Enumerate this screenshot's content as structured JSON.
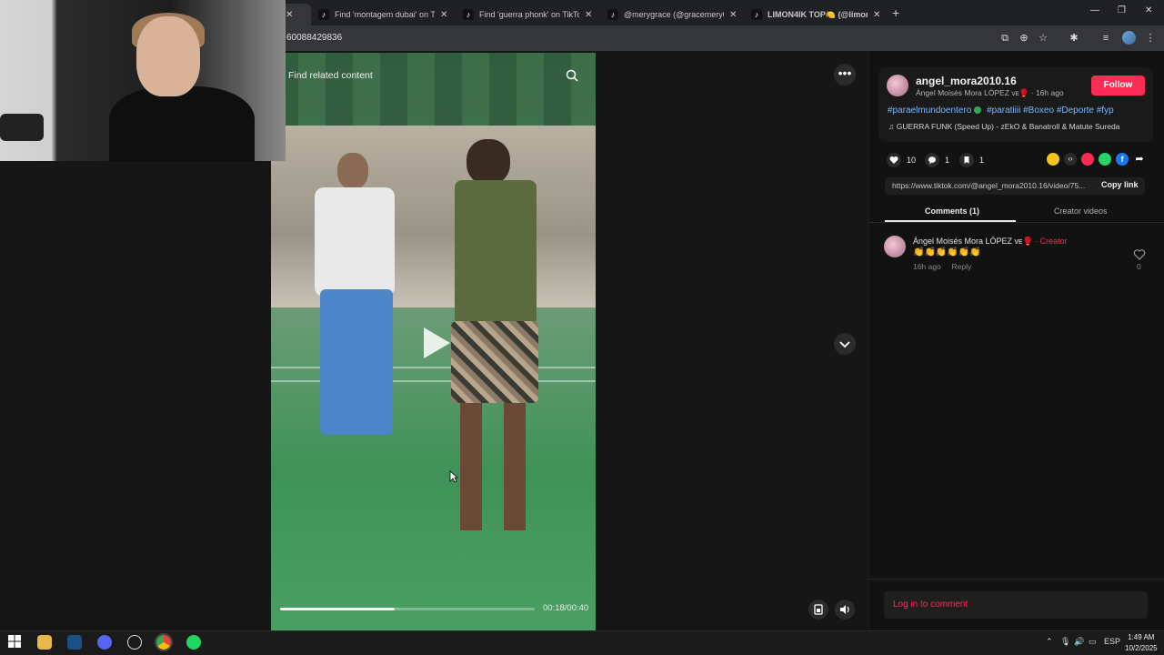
{
  "browser": {
    "tabs": [
      {
        "label": "Find 'montagem dubai' on TikTok",
        "active": true
      },
      {
        "label": "Find 'guerra phonk' on TikTok",
        "active": false
      },
      {
        "label": "@merygrace (@gracemery09) | TikTok",
        "active": false
      },
      {
        "label": "LIMON4IK TOP🍋 (@limon4ik) | TikTok",
        "active": false
      }
    ],
    "url": "60088429836",
    "new_tab": "+"
  },
  "video": {
    "find_related": "Find related content",
    "timecode": "00:18/00:40",
    "progress": 0.45
  },
  "post": {
    "username": "angel_mora2010.16",
    "display_name": "Ángel Moisés Mora LÓPEZ ᴠᴇ🥊",
    "sep": "·",
    "time_ago": "16h ago",
    "follow_label": "Follow",
    "hashtags": [
      "#paraelmundoentero",
      "#paratiiii",
      "#Boxeo",
      "#Deporte",
      "#fyp"
    ],
    "music_icon": "♫",
    "music": "GUERRA FUNK (Speed Up) - zEkO & Banatroll & Matute Sureda",
    "likes": "10",
    "comments_count": "1",
    "saves": "1",
    "share_colors": {
      "embed": "#2a2a2a",
      "friends": "#fe2c55",
      "whatsapp": "#25d366",
      "facebook": "#1877f2",
      "share": "#2a2a2a",
      "emoji": "#f5c518"
    },
    "link": "https://www.tiktok.com/@angel_mora2010.16/video/75...",
    "copy_link": "Copy link"
  },
  "tabs": {
    "comments": "Comments (1)",
    "creator_videos": "Creator videos"
  },
  "comment": {
    "author": "Ángel Moisés Mora LÓPEZ ᴠᴇ🥊",
    "creator_tag": "· Creator",
    "text": "👏👏👏👏👏👏",
    "time": "16h ago",
    "reply": "Reply",
    "likes": "0"
  },
  "comment_input": {
    "placeholder": "Log in to comment"
  },
  "taskbar": {
    "lang": "ESP",
    "time": "1:49 AM",
    "date": "10/2/2025"
  },
  "colors": {
    "accent": "#fe2c55",
    "hashtag": "#7ab8ff"
  }
}
